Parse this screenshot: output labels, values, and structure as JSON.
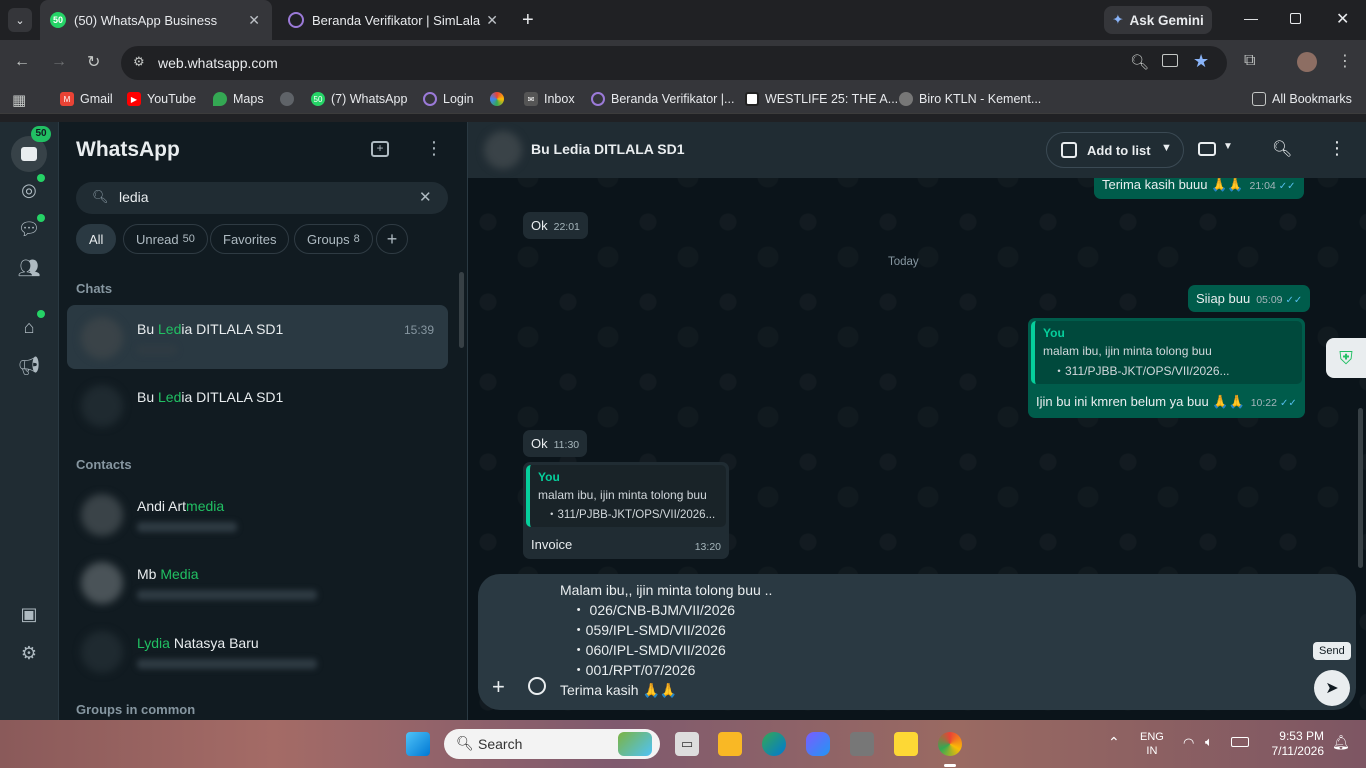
{
  "browser": {
    "tabs": [
      {
        "title": "(50) WhatsApp Business",
        "badge": "50",
        "active": true
      },
      {
        "title": "Beranda Verifikator | SimLala",
        "active": false
      }
    ],
    "ask_gemini": "Ask Gemini",
    "url": "web.whatsapp.com",
    "bookmarks": [
      {
        "label": "Gmail",
        "color": "#ea4335"
      },
      {
        "label": "YouTube",
        "color": "#ff0000"
      },
      {
        "label": "Maps",
        "color": "#34a853"
      },
      {
        "label": "(7) WhatsApp",
        "color": "#25d366"
      },
      {
        "label": "Login",
        "color": "#7e57c2"
      },
      {
        "label": "Inbox",
        "color": "#555"
      },
      {
        "label": "Beranda Verifikator |...",
        "color": "#7e57c2"
      },
      {
        "label": "WESTLIFE 25: THE A...",
        "color": "#222"
      },
      {
        "label": "Biro KTLN - Kement...",
        "color": "#777"
      }
    ],
    "all_bookmarks": "All Bookmarks"
  },
  "rail": {
    "unread_badge": "50"
  },
  "sidebar": {
    "title": "WhatsApp",
    "search_value": "ledia",
    "filters": [
      {
        "label": "All",
        "count": ""
      },
      {
        "label": "Unread",
        "count": "50"
      },
      {
        "label": "Favorites",
        "count": ""
      },
      {
        "label": "Groups",
        "count": "8"
      }
    ],
    "chats_header": "Chats",
    "contacts_header": "Contacts",
    "groups_header": "Groups in common",
    "chats": [
      {
        "pre": "Bu ",
        "hl": "Led",
        "post": "ia DITLALA SD1",
        "time": "15:39"
      },
      {
        "pre": "Bu ",
        "hl": "Led",
        "post": "ia DITLALA SD1",
        "time": ""
      }
    ],
    "contacts": [
      {
        "pre": "Andi Art",
        "hl": "media",
        "post": ""
      },
      {
        "pre": "Mb ",
        "hl": "Media",
        "post": ""
      },
      {
        "pre": "",
        "hl": "Lydia",
        "post": " Natasya Baru"
      }
    ]
  },
  "conversation": {
    "name": "Bu Ledia DITLALA SD1",
    "add_to_list": "Add to list",
    "day_chip": "Today",
    "messages": {
      "m1": {
        "text": "Terima kasih buuu 🙏🙏",
        "time": "21:04"
      },
      "m2": {
        "text": "Ok",
        "time": "22:01"
      },
      "m3": {
        "text": "Siiap buu",
        "time": "05:09"
      },
      "m4": {
        "quote_author": "You",
        "quote_line1": "malam ibu, ijin minta tolong buu",
        "quote_line2": "・311/PJBB-JKT/OPS/VII/2026...",
        "text": "Ijin bu ini kmren belum ya buu 🙏🙏",
        "time": "10:22"
      },
      "m5": {
        "text": "Ok",
        "time": "11:30"
      },
      "m6": {
        "quote_author": "You",
        "quote_line1": "malam ibu, ijin minta tolong buu",
        "quote_line2": "・311/PJBB-JKT/OPS/VII/2026...",
        "text": "Invoice",
        "time": "13:20"
      }
    },
    "composer_lines": [
      "Malam ibu,, ijin minta tolong buu ..",
      "   ・ 026/CNB-BJM/VII/2026",
      "   ・059/IPL-SMD/VII/2026",
      "   ・060/IPL-SMD/VII/2026",
      "   ・001/RPT/07/2026",
      "Terima kasih 🙏🙏"
    ],
    "send_tooltip": "Send"
  },
  "taskbar": {
    "search_placeholder": "Search",
    "lang": "ENG",
    "lang_sub": "IN",
    "time": "9:53 PM",
    "date": "7/11/2026"
  }
}
